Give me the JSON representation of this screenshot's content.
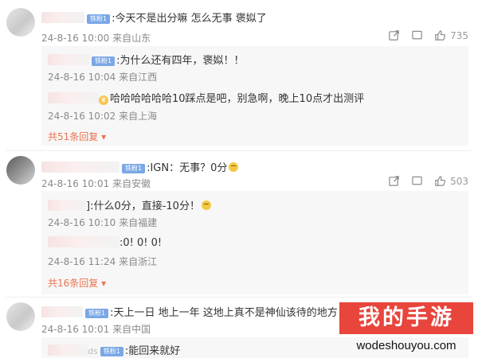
{
  "badge_label": "铁粉1",
  "threads": [
    {
      "text": ":今天不是出分嘛 怎么无事 褒姒了",
      "time": "24-8-16 10:00",
      "location": "来自山东",
      "likes": "735",
      "replies": [
        {
          "text": ":为什么还有四年，褒姒！！",
          "time": "24-8-16 10:04",
          "location": "来自江西"
        },
        {
          "text": "哈哈哈哈哈哈10踩点是吧，别急啊，晚上10点才出测评",
          "time": "24-8-16 10:02",
          "location": "来自上海"
        }
      ],
      "more": "共51条回复"
    },
    {
      "text": ":IGN：无事？0分",
      "time": "24-8-16 10:01",
      "location": "来自安徽",
      "likes": "503",
      "replies": [
        {
          "text": "]:什么0分，直接-10分！",
          "time": "24-8-16 10:10",
          "location": "来自福建"
        },
        {
          "text": ":0!  0!  0!",
          "time": "24-8-16 11:24",
          "location": "来自浙江"
        }
      ],
      "more": "共16条回复"
    },
    {
      "text": ":天上一日 地上一年 这地上真不是神仙该待的地方",
      "time": "24-8-16 10:01",
      "location": "来自中国",
      "replies": [
        {
          "text": ":能回来就好",
          "name_tail": "ds"
        }
      ]
    }
  ],
  "watermark": {
    "title": "我的手游",
    "url": "wodeshouyou.com"
  },
  "colors": {
    "accent": "#eb7350",
    "badge": "#7aa7e6",
    "watermark": "#e8453c"
  },
  "icons": [
    "share-icon",
    "comment-icon",
    "thumb-up-icon",
    "chevron-down-icon"
  ]
}
